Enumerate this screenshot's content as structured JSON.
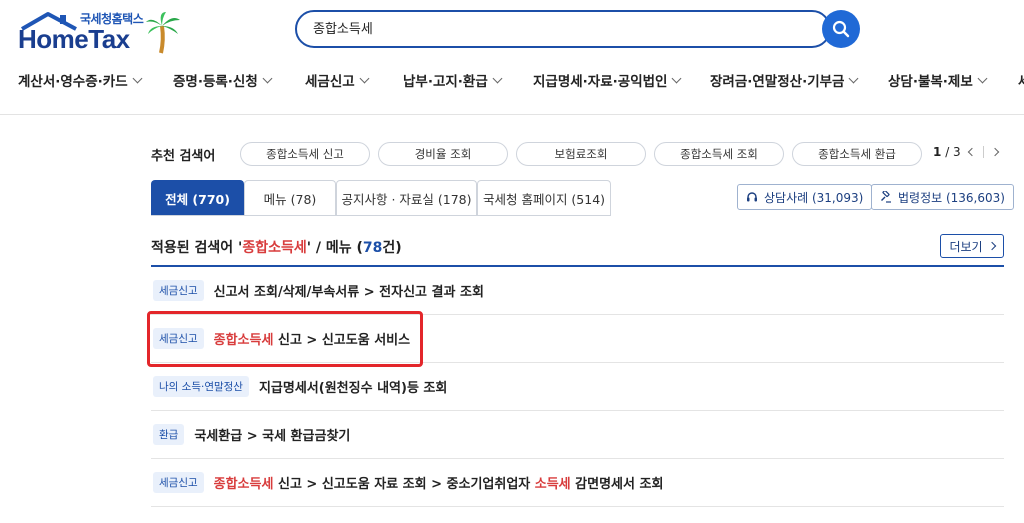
{
  "logo": {
    "subtitle": "국세청홈택스",
    "title": "HomeTax"
  },
  "search": {
    "value": "종합소득세"
  },
  "gnb": [
    {
      "label": "계산서·영수증·카드"
    },
    {
      "label": "증명·등록·신청"
    },
    {
      "label": "세금신고"
    },
    {
      "label": "납부·고지·환급"
    },
    {
      "label": "지급명세·자료·공익법인"
    },
    {
      "label": "장려금·연말정산·기부금"
    },
    {
      "label": "상담·불복·제보"
    },
    {
      "label": "세"
    }
  ],
  "recommended": {
    "label": "추천 검색어",
    "chips": [
      "종합소득세 신고",
      "경비율 조회",
      "보험료조회",
      "종합소득세 조회",
      "종합소득세 환급"
    ],
    "page_current": "1",
    "page_total": "/ 3"
  },
  "tabs": [
    {
      "label": "전체 (770)",
      "active": true
    },
    {
      "label": "메뉴 (78)"
    },
    {
      "label": "공지사항 · 자료실 (178)"
    },
    {
      "label": "국세청 홈페이지 (514)"
    }
  ],
  "info_buttons": [
    {
      "label": "상담사례 (31,093)",
      "icon": "headset-icon"
    },
    {
      "label": "법령정보 (136,603)",
      "icon": "gavel-icon"
    }
  ],
  "applied": {
    "prefix": "적용된 검색어 '",
    "keyword": "종합소득세",
    "middle": "' / 메뉴 (",
    "count": "78",
    "suffix": "건)",
    "more_label": "더보기"
  },
  "results": [
    {
      "badge": "세금신고",
      "pre": "",
      "hl1": "",
      "mid": "신고서 조회/삭제/부속서류 > 전자신고 결과 조회",
      "hl2": "",
      "post": ""
    },
    {
      "badge": "세금신고",
      "pre": "",
      "hl1": "종합소득세",
      "mid": " 신고 > 신고도움 서비스",
      "hl2": "",
      "post": ""
    },
    {
      "badge": "나의 소득·연말정산",
      "pre": "",
      "hl1": "",
      "mid": "지급명세서(원천징수 내역)등 조회",
      "hl2": "",
      "post": ""
    },
    {
      "badge": "환급",
      "pre": "",
      "hl1": "",
      "mid": "국세환급 > 국세 환급금찾기",
      "hl2": "",
      "post": ""
    },
    {
      "badge": "세금신고",
      "pre": "",
      "hl1": "종합소득세",
      "mid": " 신고 > 신고도움 자료 조회 > 중소기업취업자 ",
      "hl2": "소득세",
      "post": " 감면명세서 조회"
    }
  ],
  "colors": {
    "brand": "#1c4fa8",
    "highlight": "#d83c3c",
    "annotation_box": "#e3262a"
  }
}
